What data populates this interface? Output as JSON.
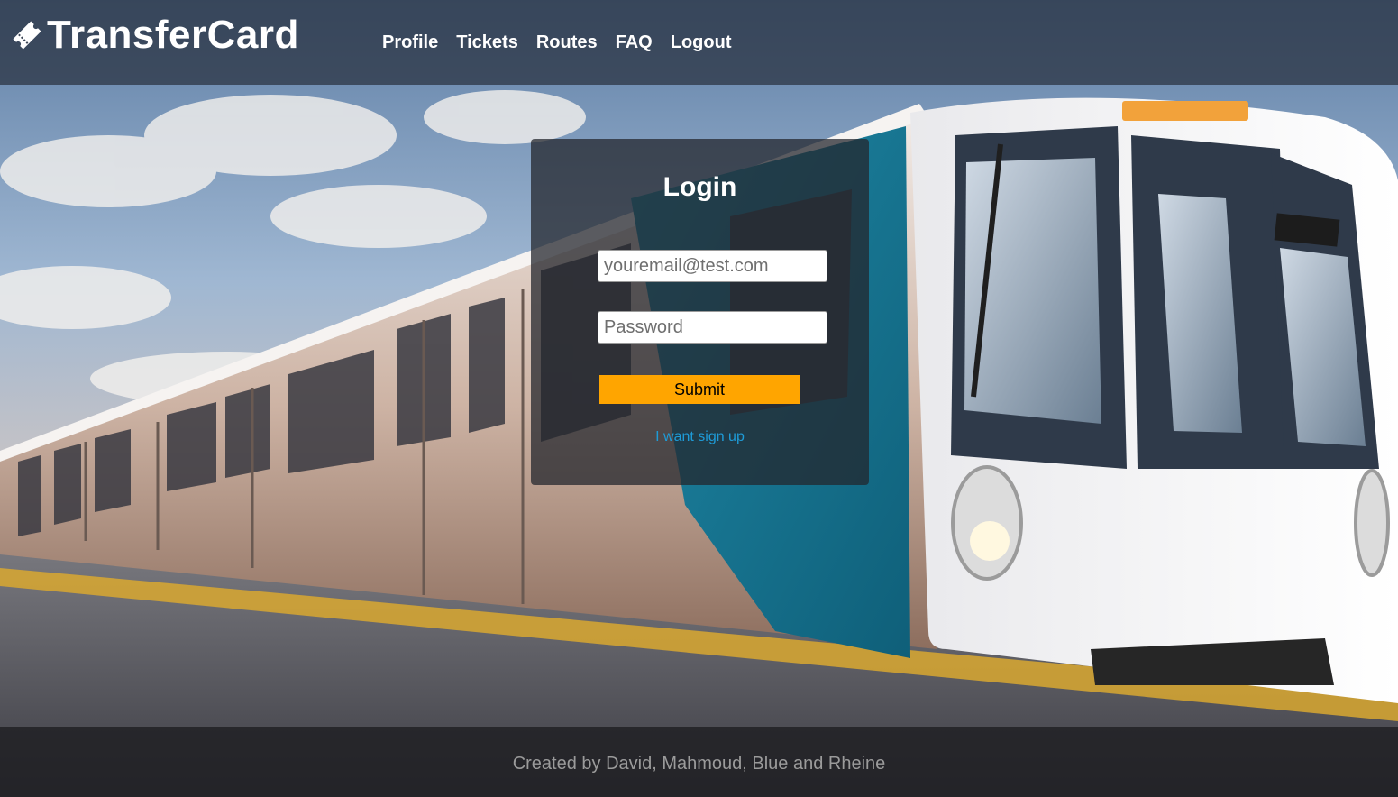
{
  "brand": {
    "name": "TransferCard",
    "icon": "ticket-icon"
  },
  "nav": {
    "items": [
      "Profile",
      "Tickets",
      "Routes",
      "FAQ",
      "Logout"
    ]
  },
  "login": {
    "title": "Login",
    "email_placeholder": "youremail@test.com",
    "password_placeholder": "Password",
    "submit_label": "Submit",
    "signup_link": "I want sign up"
  },
  "footer": {
    "credits": "Created by David, Mahmoud, Blue and Rheine"
  },
  "colors": {
    "submit_bg": "#ffa500",
    "link": "#1e9bd7",
    "train_accent": "#1a7f9c"
  }
}
